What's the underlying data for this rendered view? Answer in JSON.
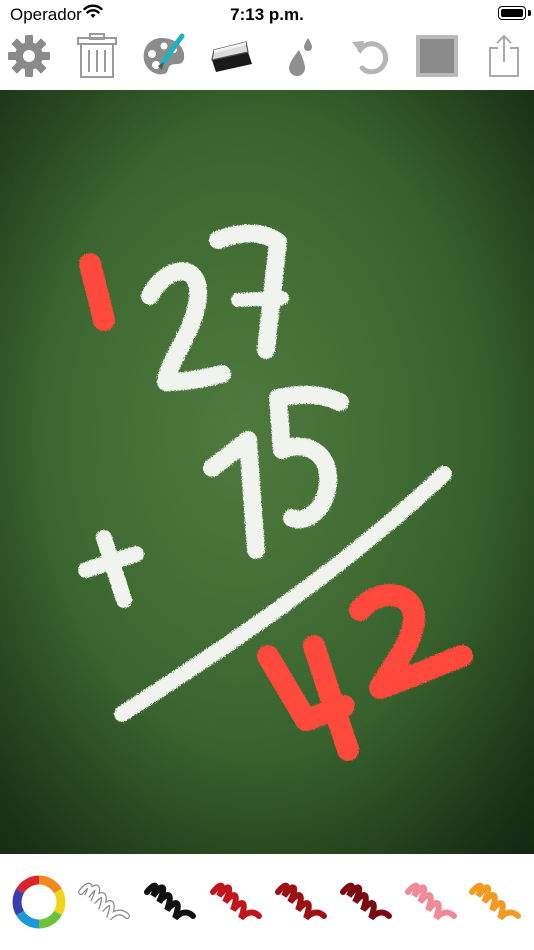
{
  "status_bar": {
    "carrier": "Operador",
    "time": "7:13 p.m."
  },
  "toolbar": {
    "tools": [
      "gear-icon",
      "trash-icon",
      "palette-icon",
      "eraser-icon",
      "drop-icon",
      "undo-icon",
      "background-icon",
      "share-icon"
    ]
  },
  "canvas": {
    "background_color": "#3f6a32",
    "chalk_color": "#f1f4ee",
    "accent_color": "#ff4a3d"
  },
  "palette": {
    "swatches": [
      {
        "name": "color-wheel",
        "color": "multicolor"
      },
      {
        "name": "brush-white",
        "color": "#ffffff"
      },
      {
        "name": "brush-black",
        "color": "#111111"
      },
      {
        "name": "brush-red",
        "color": "#c0151b"
      },
      {
        "name": "brush-dark-red",
        "color": "#9e0e15"
      },
      {
        "name": "brush-maroon",
        "color": "#7a0b10"
      },
      {
        "name": "brush-pink",
        "color": "#f08a96"
      },
      {
        "name": "brush-orange",
        "color": "#f29a21"
      }
    ]
  }
}
